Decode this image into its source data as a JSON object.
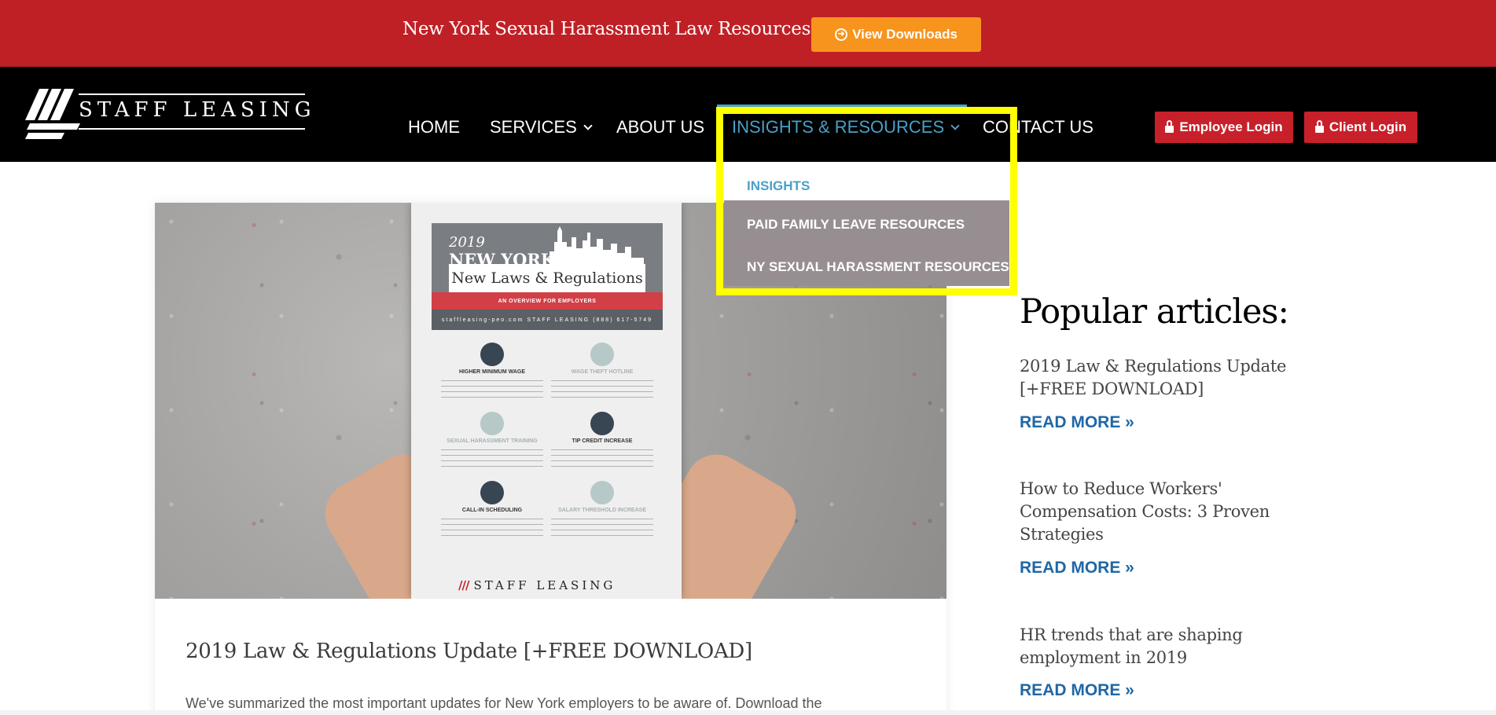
{
  "banner": {
    "title": "New York Sexual Harassment Law Resources",
    "button_label": "View Downloads",
    "bg_color": "#bf2026",
    "button_color": "#f7941d"
  },
  "header": {
    "logo_text": "STAFF LEASING",
    "nav": [
      {
        "label": "HOME"
      },
      {
        "label": "SERVICES"
      },
      {
        "label": "ABOUT US"
      },
      {
        "label": "INSIGHTS & RESOURCES"
      },
      {
        "label": "CONTACT US"
      }
    ],
    "employee_login": "Employee Login",
    "client_login": "Client Login",
    "active_color": "#4a9fc8"
  },
  "dropdown": {
    "items": [
      {
        "label": "INSIGHTS"
      },
      {
        "label": "PAID FAMILY LEAVE RESOURCES"
      },
      {
        "label": "NY SEXUAL HARASSMENT RESOURCES"
      }
    ],
    "highlight_color": "#ffff00"
  },
  "poster": {
    "year": "2019",
    "city": "NEW YORK",
    "subtitle": "New Laws & Regulations",
    "tagline": "AN OVERVIEW FOR EMPLOYERS",
    "brand_row": "staffleasing-peo.com   STAFF LEASING   (888) 617-5749",
    "sections": [
      {
        "heading": "HIGHER MINIMUM WAGE"
      },
      {
        "heading": "WAGE THEFT HOTLINE"
      },
      {
        "heading": "SEXUAL HARASSMENT TRAINING"
      },
      {
        "heading": "TIP CREDIT INCREASE"
      },
      {
        "heading": "CALL-IN SCHEDULING"
      },
      {
        "heading": "SALARY THRESHOLD INCREASE"
      }
    ],
    "footer_logo": "STAFF LEASING"
  },
  "article": {
    "title": "2019 Law & Regulations Update [+FREE DOWNLOAD]",
    "excerpt": "We've summarized the most important updates for New York employers to be aware of. Download the"
  },
  "sidebar": {
    "title": "Popular articles:",
    "articles": [
      {
        "title": "2019 Law & Regulations Update [+FREE DOWNLOAD]",
        "read_more": "READ MORE »"
      },
      {
        "title": "How to Reduce Workers' Compensation Costs: 3 Proven Strategies",
        "read_more": "READ MORE »"
      },
      {
        "title": "HR trends that are shaping employment in 2019",
        "read_more": "READ MORE »"
      }
    ]
  }
}
